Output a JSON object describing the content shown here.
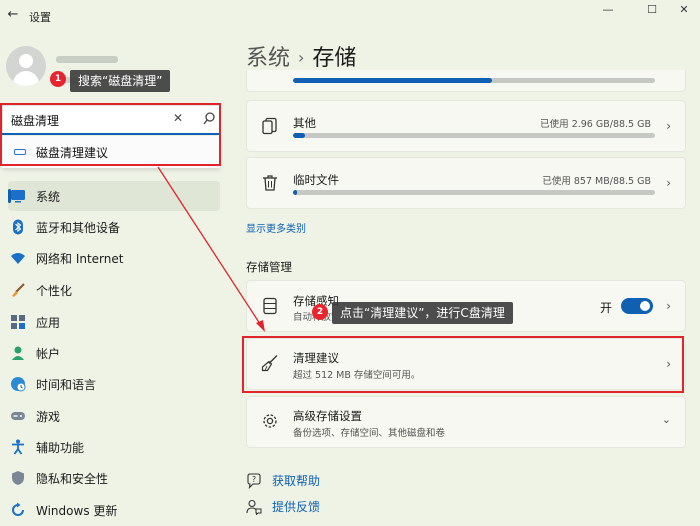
{
  "window": {
    "title": "设置",
    "back": "←",
    "minimize": "—",
    "maximize": "☐",
    "close": "✕"
  },
  "account": {
    "name": "",
    "email": ""
  },
  "annotations": {
    "step1": {
      "number": "1",
      "text": "搜索“磁盘清理”"
    },
    "step2": {
      "number": "2",
      "text": "点击“清理建议”，进行C盘清理"
    }
  },
  "search": {
    "value": "磁盘清理",
    "clear": "✕",
    "suggestion": "磁盘清理建议"
  },
  "sidebar": {
    "items": [
      {
        "label": "系统",
        "icon": "monitor-icon",
        "active": true
      },
      {
        "label": "蓝牙和其他设备",
        "icon": "bluetooth-icon"
      },
      {
        "label": "网络和 Internet",
        "icon": "wifi-icon"
      },
      {
        "label": "个性化",
        "icon": "brush-icon"
      },
      {
        "label": "应用",
        "icon": "apps-icon"
      },
      {
        "label": "帐户",
        "icon": "person-icon"
      },
      {
        "label": "时间和语言",
        "icon": "globe-clock-icon"
      },
      {
        "label": "游戏",
        "icon": "gamepad-icon"
      },
      {
        "label": "辅助功能",
        "icon": "accessibility-icon"
      },
      {
        "label": "隐私和安全性",
        "icon": "shield-icon"
      },
      {
        "label": "Windows 更新",
        "icon": "update-icon"
      }
    ]
  },
  "header": {
    "crumb": "系统",
    "separator": "›",
    "title": "存储"
  },
  "storage": {
    "top_bar_fill": 0.55,
    "categories": [
      {
        "name": "其他",
        "used": "已使用 2.96 GB/88.5 GB",
        "fill": 0.034,
        "icon": "other-files-icon"
      },
      {
        "name": "临时文件",
        "used": "已使用 857 MB/88.5 GB",
        "fill": 0.012,
        "icon": "trash-icon"
      }
    ],
    "show_more": "显示更多类别"
  },
  "management": {
    "section_title": "存储管理",
    "items": [
      {
        "title": "存储感知",
        "subtitle": "自动释放空间，删除临时文件，并管理本地可用的云内容",
        "toggle_label": "开",
        "toggle_on": true,
        "icon": "storage-drive-icon"
      },
      {
        "title": "清理建议",
        "subtitle": "超过 512 MB 存储空间可用。",
        "icon": "broom-icon"
      },
      {
        "title": "高级存储设置",
        "subtitle": "备份选项、存储空间、其他磁盘和卷",
        "icon": "gear-icon"
      }
    ]
  },
  "help": {
    "get_help": "获取帮助",
    "feedback": "提供反馈"
  },
  "colors": {
    "accent": "#0f5fb3",
    "highlight": "#e0242c",
    "background": "#eef3e6"
  }
}
